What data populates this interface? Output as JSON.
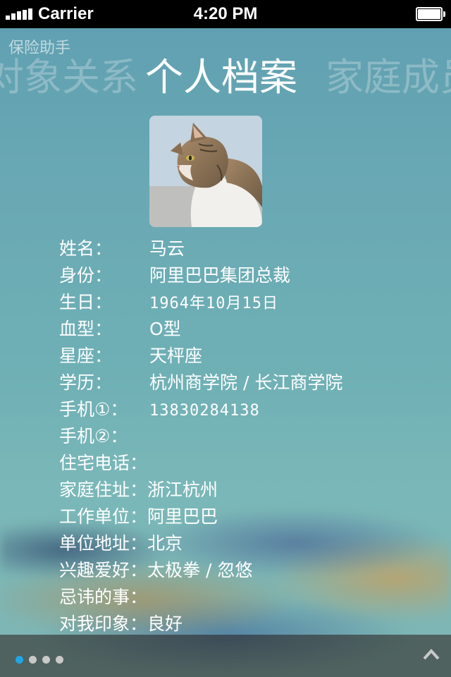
{
  "status_bar": {
    "carrier": "Carrier",
    "time": "4:20 PM"
  },
  "app_label": "保险助手",
  "tabs": {
    "left": "对象关系",
    "center": "个人档案",
    "right": "家庭成员"
  },
  "avatar": {
    "icon": "cat-photo"
  },
  "profile": {
    "name": {
      "label": "姓名：",
      "value": "马云"
    },
    "identity": {
      "label": "身份：",
      "value": "阿里巴巴集团总裁"
    },
    "birthday": {
      "label": "生日：",
      "value": "1964年10月15日"
    },
    "blood_type": {
      "label": "血型：",
      "value": "O型"
    },
    "zodiac": {
      "label": "星座：",
      "value": "天枰座"
    },
    "education": {
      "label": "学历：",
      "value": "杭州商学院 / 长江商学院"
    },
    "mobile1": {
      "label": "手机①：",
      "value": "13830284138"
    },
    "mobile2": {
      "label": "手机②：",
      "value": ""
    },
    "home_phone": {
      "label": "住宅电话：",
      "value": ""
    },
    "home_address": {
      "label": "家庭住址：",
      "value": "浙江杭州"
    },
    "employer": {
      "label": "工作单位：",
      "value": "阿里巴巴"
    },
    "work_address": {
      "label": "单位地址：",
      "value": "北京"
    },
    "hobbies": {
      "label": "兴趣爱好：",
      "value": "太极拳 / 忽悠"
    },
    "taboos": {
      "label": "忌讳的事：",
      "value": ""
    },
    "impression": {
      "label": "对我印象：",
      "value": "良好"
    }
  },
  "pager": {
    "total": 4,
    "active": 1,
    "active_color": "#1ea7e8"
  },
  "bottom_bar": {
    "up_icon": "chevron-up-icon"
  }
}
